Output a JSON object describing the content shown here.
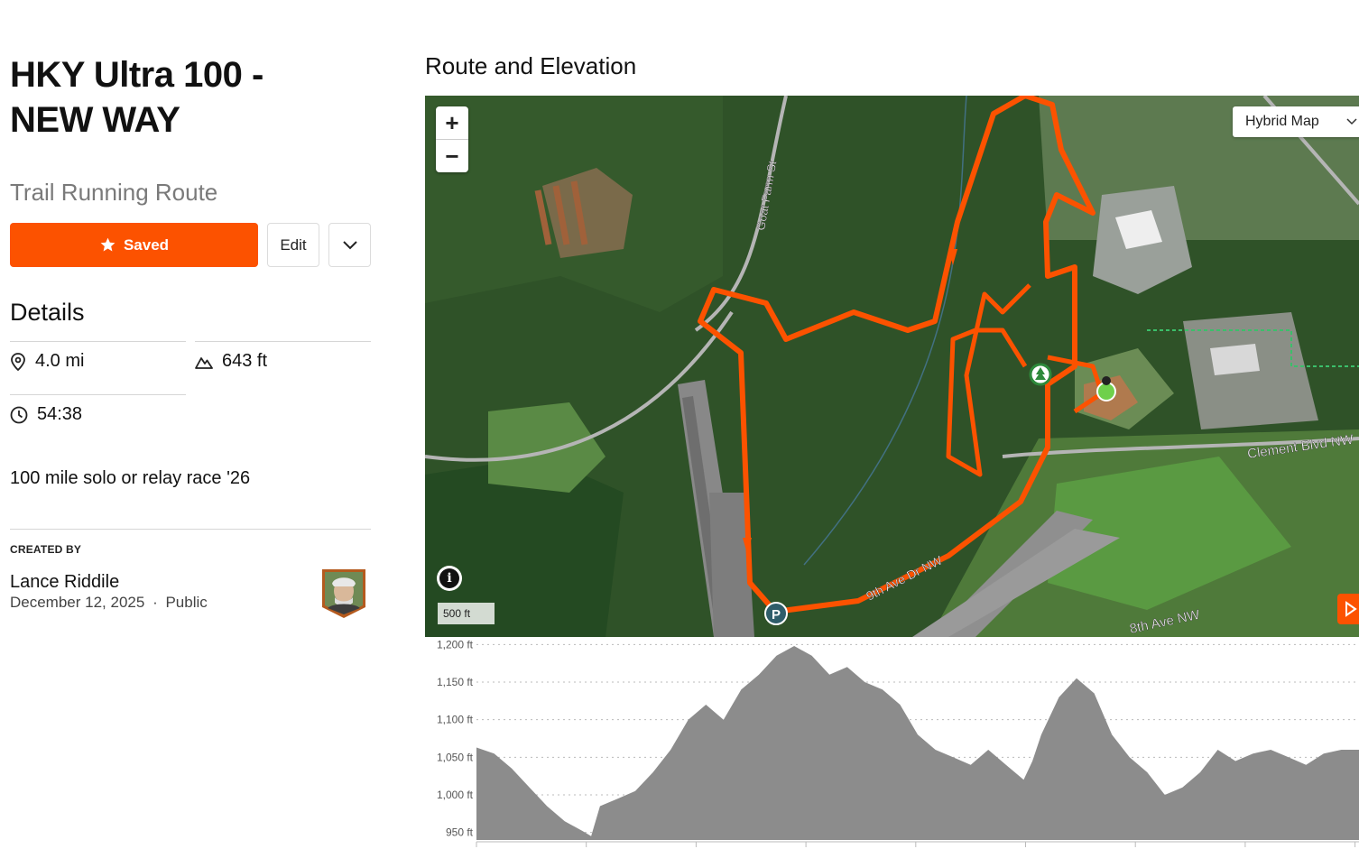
{
  "route": {
    "title": "HKY Ultra 100 - NEW WAY",
    "type": "Trail Running Route",
    "description": "100 mile solo or relay race '26"
  },
  "actions": {
    "saved_label": "Saved",
    "edit_label": "Edit"
  },
  "details": {
    "heading": "Details",
    "distance": "4.0 mi",
    "elevation_gain": "643 ft",
    "time": "54:38"
  },
  "creator": {
    "label": "CREATED BY",
    "name": "Lance Riddile",
    "date": "December 12, 2025",
    "separator": "·",
    "visibility": "Public"
  },
  "map": {
    "heading": "Route and Elevation",
    "zoom_in": "+",
    "zoom_out": "−",
    "map_type": "Hybrid Map",
    "scale": "500 ft",
    "info": "i",
    "road_labels": [
      "Goat Farm St",
      "9th Ave Dr NW",
      "Clement Blvd NW",
      "8th Ave NW"
    ],
    "route_color": "#fc5200"
  },
  "chart_data": {
    "type": "area",
    "ylabel": "",
    "ylim": [
      940,
      1210
    ],
    "yticks": [
      "1,200 ft",
      "1,150 ft",
      "1,100 ft",
      "1,050 ft",
      "1,000 ft",
      "950 ft"
    ],
    "ytick_values": [
      1200,
      1150,
      1100,
      1050,
      1000,
      950
    ],
    "x": [
      0,
      0.02,
      0.04,
      0.06,
      0.08,
      0.1,
      0.12,
      0.13,
      0.14,
      0.16,
      0.18,
      0.2,
      0.22,
      0.24,
      0.26,
      0.28,
      0.3,
      0.32,
      0.34,
      0.36,
      0.38,
      0.4,
      0.42,
      0.44,
      0.46,
      0.48,
      0.5,
      0.52,
      0.54,
      0.56,
      0.58,
      0.6,
      0.62,
      0.63,
      0.64,
      0.66,
      0.68,
      0.7,
      0.72,
      0.74,
      0.76,
      0.78,
      0.8,
      0.82,
      0.84,
      0.86,
      0.88,
      0.9,
      0.92,
      0.94,
      0.96,
      0.98,
      1.0
    ],
    "values": [
      1063,
      1055,
      1035,
      1010,
      985,
      965,
      952,
      945,
      985,
      995,
      1005,
      1030,
      1060,
      1100,
      1120,
      1100,
      1140,
      1160,
      1185,
      1198,
      1185,
      1160,
      1170,
      1150,
      1140,
      1120,
      1080,
      1060,
      1050,
      1040,
      1060,
      1040,
      1020,
      1045,
      1080,
      1130,
      1155,
      1135,
      1080,
      1050,
      1030,
      1000,
      1010,
      1030,
      1060,
      1045,
      1055,
      1060,
      1050,
      1040,
      1055,
      1060,
      1060
    ],
    "fill_color": "#8c8c8c"
  }
}
